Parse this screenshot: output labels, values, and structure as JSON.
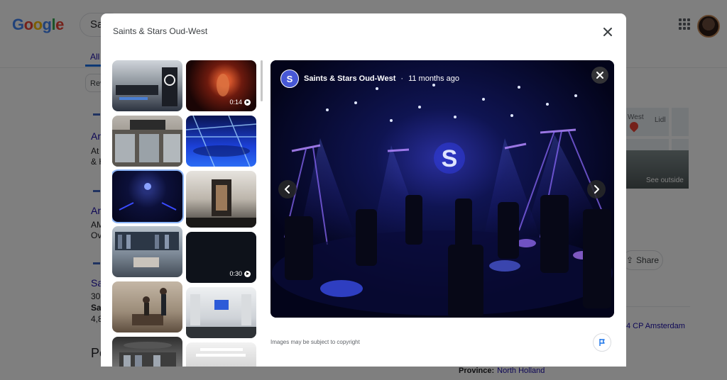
{
  "background": {
    "logo": "Google",
    "search_value": "Sa",
    "tab_all": "All",
    "chip": "Rev",
    "results": [
      {
        "title": "An",
        "lines": [
          "At S",
          "& H"
        ]
      },
      {
        "title": "An",
        "lines": [
          "AMS",
          "Ove"
        ]
      },
      {
        "title": "Sa",
        "lines": [
          "30",
          "Sai",
          "4,8"
        ]
      }
    ],
    "section_heading": "Pe",
    "map": {
      "label_west": "West",
      "label_lidl": "Lidl",
      "see_outside": "See outside"
    },
    "share_label": "Share",
    "address_tail": "4 CP Amsterdam",
    "province_label": "Province:",
    "province_value": "North Holland"
  },
  "modal": {
    "title": "Saints & Stars Oud-West",
    "thumbnails": [
      {
        "kind": "image",
        "subject": "store-interior"
      },
      {
        "kind": "video",
        "duration": "0:14",
        "subject": "red-lit-figure"
      },
      {
        "kind": "image",
        "subject": "storefront"
      },
      {
        "kind": "image",
        "subject": "blue-cycling-studio"
      },
      {
        "kind": "image",
        "subject": "dark-studio",
        "selected": true
      },
      {
        "kind": "image",
        "subject": "corridor"
      },
      {
        "kind": "image",
        "subject": "retail-shelves"
      },
      {
        "kind": "video",
        "duration": "0:30",
        "subject": "dark-video"
      },
      {
        "kind": "image",
        "subject": "people-reception"
      },
      {
        "kind": "image",
        "subject": "locker-room"
      },
      {
        "kind": "image",
        "subject": "boutique"
      },
      {
        "kind": "image",
        "subject": "hallway"
      }
    ],
    "viewer": {
      "source_name": "Saints & Stars Oud-West",
      "separator": "·",
      "time_ago": "11 months ago",
      "avatar_letter": "S",
      "logo_letter": "S"
    },
    "copyright": "Images may be subject to copyright"
  },
  "colors": {
    "scrim": "rgba(0,0,0,0.5)",
    "studio_blue": "#3a3cff",
    "selected_outline": "#8ab4f8",
    "link": "#1a0dab"
  },
  "icons": [
    "close-icon",
    "chevron-left-icon",
    "chevron-right-icon",
    "flag-icon",
    "play-icon",
    "apps-icon"
  ]
}
